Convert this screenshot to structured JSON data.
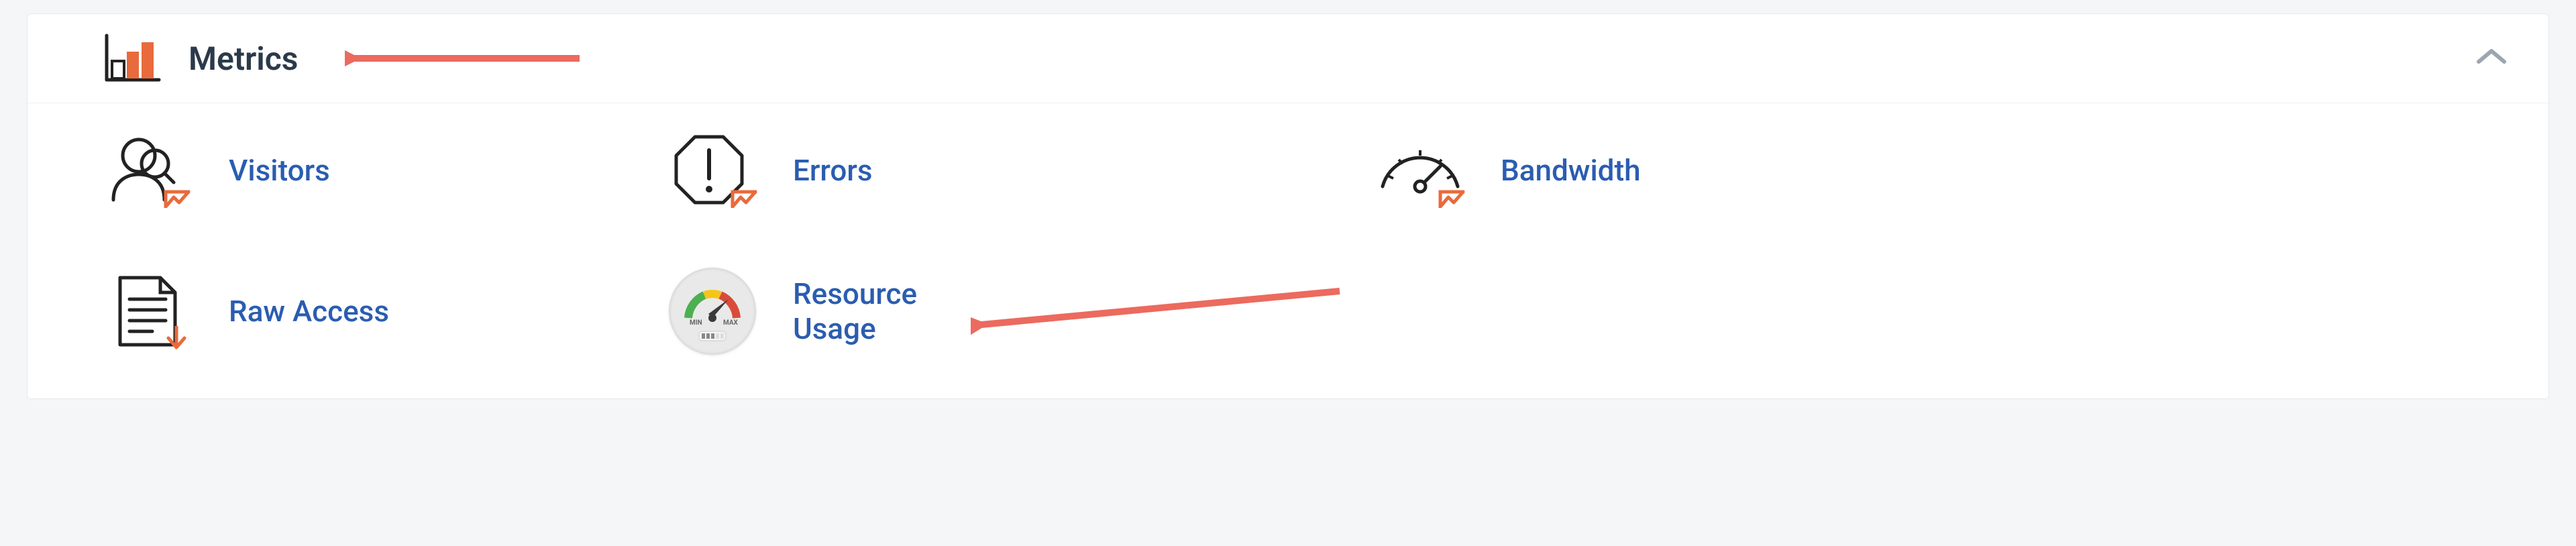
{
  "panel": {
    "title": "Metrics",
    "collapsed": false
  },
  "items": {
    "visitors": {
      "label": "Visitors"
    },
    "errors": {
      "label": "Errors"
    },
    "bandwidth": {
      "label": "Bandwidth"
    },
    "rawaccess": {
      "label": "Raw Access"
    },
    "resource": {
      "label": "Resource Usage"
    }
  },
  "annotations": {
    "arrow_to_title": true,
    "arrow_to_resource": true
  },
  "colors": {
    "accent_orange": "#e96a3c",
    "link_blue": "#2a5db0",
    "arrow_red": "#ec6a5e"
  }
}
